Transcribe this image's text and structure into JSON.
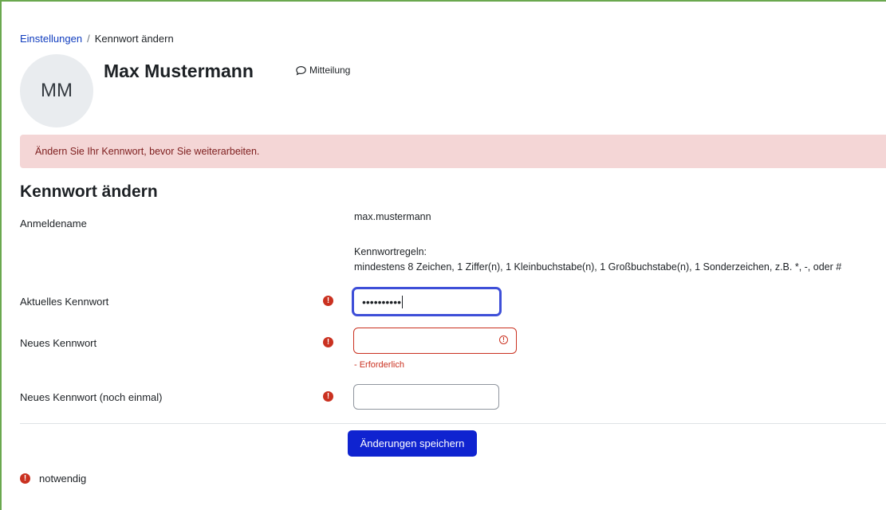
{
  "breadcrumb": {
    "parent": "Einstellungen",
    "separator": "/",
    "current": "Kennwort ändern"
  },
  "user": {
    "initials": "MM",
    "name": "Max Mustermann",
    "message_label": "Mitteilung"
  },
  "alert": {
    "text": "Ändern Sie Ihr Kennwort, bevor Sie weiterarbeiten."
  },
  "form": {
    "title": "Kennwort ändern",
    "username_label": "Anmeldename",
    "username_value": "max.mustermann",
    "rules_heading": "Kennwortregeln:",
    "rules_text": "mindestens 8 Zeichen, 1 Ziffer(n), 1 Kleinbuchstabe(n), 1 Großbuchstabe(n), 1 Sonderzeichen, z.B. *, -, oder #",
    "current_password_label": "Aktuelles Kennwort",
    "current_password_value": "••••••••••",
    "new_password_label": "Neues Kennwort",
    "new_password_value": "",
    "new_password_error": "- Erforderlich",
    "confirm_password_label": "Neues Kennwort (noch einmal)",
    "confirm_password_value": "",
    "save_label": "Änderungen speichern",
    "required_legend": "notwendig"
  },
  "icons": {
    "required": "exclamation-circle-icon",
    "message": "speech-bubble-icon",
    "error": "error-circle-icon"
  },
  "colors": {
    "primary": "#0f23d0",
    "danger": "#ca3120",
    "alert_bg": "#f4d6d6",
    "link": "#0f3cbe",
    "focus": "#3e4fd8"
  }
}
